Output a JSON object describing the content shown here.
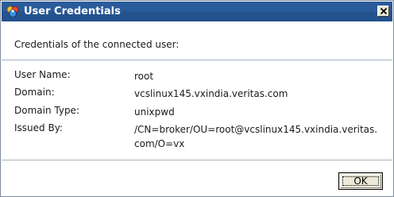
{
  "window": {
    "title": "User Credentials",
    "app_icon": "veritas-app-icon",
    "close_icon": "close-icon",
    "colors": {
      "titlebar": "#2a5b9b",
      "titlebar_text": "#ffffff",
      "body_background": "#ffffff",
      "button_face": "#ece9d8"
    }
  },
  "dialog": {
    "heading": "Credentials of the connected user:",
    "fields": [
      {
        "label": "User Name:",
        "value": "root"
      },
      {
        "label": "Domain:",
        "value": "vcslinux145.vxindia.veritas.com"
      },
      {
        "label": "Domain Type:",
        "value": "unixpwd"
      },
      {
        "label": "Issued By:",
        "value_lines": [
          "/CN=broker/OU=root@vcslinux145.vxindia.veritas.",
          "com/O=vx"
        ]
      }
    ]
  },
  "footer": {
    "ok_label": "OK"
  }
}
